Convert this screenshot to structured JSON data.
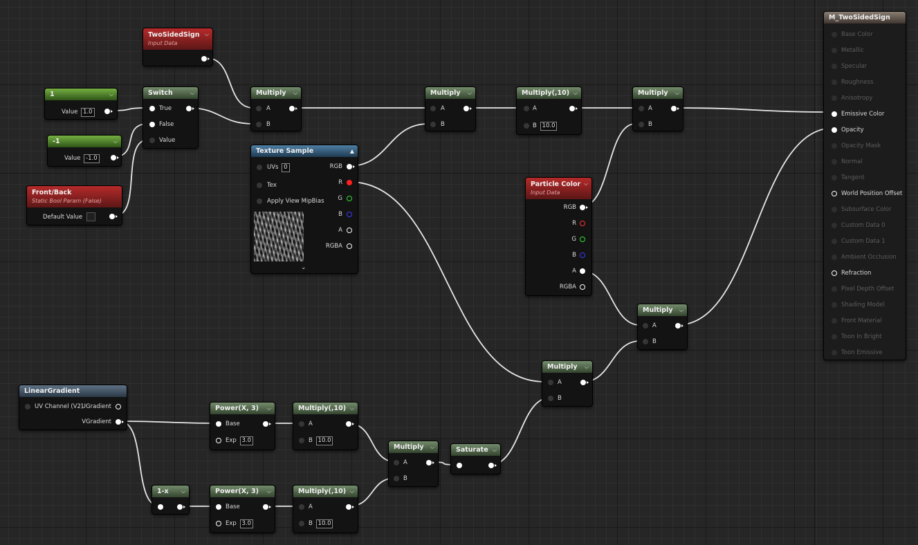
{
  "nodes": {
    "twosided": {
      "title": "TwoSidedSign",
      "sub": "Input Data"
    },
    "const1": {
      "title": "1",
      "label": "Value",
      "value": "1.0"
    },
    "constm1": {
      "title": "-1",
      "label": "Value",
      "value": "-1.0"
    },
    "switch": {
      "title": "Switch",
      "in_true": "True",
      "in_false": "False",
      "in_value": "Value"
    },
    "frontback": {
      "title": "Front/Back",
      "sub": "Static Bool Param (False)",
      "label": "Default Value"
    },
    "mul1": {
      "title": "Multiply",
      "a": "A",
      "b": "B"
    },
    "tex": {
      "title": "Texture Sample",
      "uvs": "UVs",
      "uvs_val": "0",
      "tex": "Tex",
      "mip": "Apply View MipBias",
      "rgb": "RGB",
      "r": "R",
      "g": "G",
      "b": "B",
      "a": "A",
      "rgba": "RGBA"
    },
    "mul2": {
      "title": "Multiply",
      "a": "A",
      "b": "B"
    },
    "mul10a": {
      "title": "Multiply(,10)",
      "a": "A",
      "b": "B",
      "b_val": "10.0"
    },
    "mul3": {
      "title": "Multiply",
      "a": "A",
      "b": "B"
    },
    "particle": {
      "title": "Particle Color",
      "sub": "Input Data",
      "rgb": "RGB",
      "r": "R",
      "g": "G",
      "b": "B",
      "a": "A",
      "rgba": "RGBA"
    },
    "mul4": {
      "title": "Multiply",
      "a": "A",
      "b": "B"
    },
    "mul5": {
      "title": "Multiply",
      "a": "A",
      "b": "B"
    },
    "linear": {
      "title": "LinearGradient",
      "uvch": "UV Channel (V2)",
      "ugrad": "UGradient",
      "vgrad": "VGradient"
    },
    "pow1": {
      "title": "Power(X, 3)",
      "base": "Base",
      "exp": "Exp",
      "exp_val": "3.0"
    },
    "mul10b": {
      "title": "Multiply(,10)",
      "a": "A",
      "b": "B",
      "b_val": "10.0"
    },
    "mul6": {
      "title": "Multiply",
      "a": "A",
      "b": "B"
    },
    "saturate": {
      "title": "Saturate"
    },
    "onex": {
      "title": "1-x"
    },
    "pow2": {
      "title": "Power(X, 3)",
      "base": "Base",
      "exp": "Exp",
      "exp_val": "3.0"
    },
    "mul10c": {
      "title": "Multiply(,10)",
      "a": "A",
      "b": "B",
      "b_val": "10.0"
    }
  },
  "result": {
    "title": "M_TwoSidedSign",
    "pins": [
      {
        "label": "Base Color",
        "active": false
      },
      {
        "label": "Metallic",
        "active": false
      },
      {
        "label": "Specular",
        "active": false
      },
      {
        "label": "Roughness",
        "active": false
      },
      {
        "label": "Anisotropy",
        "active": false
      },
      {
        "label": "Emissive Color",
        "active": true,
        "connected": true
      },
      {
        "label": "Opacity",
        "active": true,
        "connected": true
      },
      {
        "label": "Opacity Mask",
        "active": false
      },
      {
        "label": "Normal",
        "active": false
      },
      {
        "label": "Tangent",
        "active": false
      },
      {
        "label": "World Position Offset",
        "active": true,
        "connected": false
      },
      {
        "label": "Subsurface Color",
        "active": false
      },
      {
        "label": "Custom Data 0",
        "active": false
      },
      {
        "label": "Custom Data 1",
        "active": false
      },
      {
        "label": "Ambient Occlusion",
        "active": false
      },
      {
        "label": "Refraction",
        "active": true,
        "connected": false
      },
      {
        "label": "Pixel Depth Offset",
        "active": false
      },
      {
        "label": "Shading Model",
        "active": false
      },
      {
        "label": "Front Material",
        "active": false
      },
      {
        "label": "Toon In Bright",
        "active": false
      },
      {
        "label": "Toon Emissive",
        "active": false
      }
    ]
  },
  "colors": {
    "wire": "#e8e8e8",
    "red_header": "#b62a2a",
    "green_header": "#748c6c",
    "blue_header": "#4f7fa4"
  }
}
